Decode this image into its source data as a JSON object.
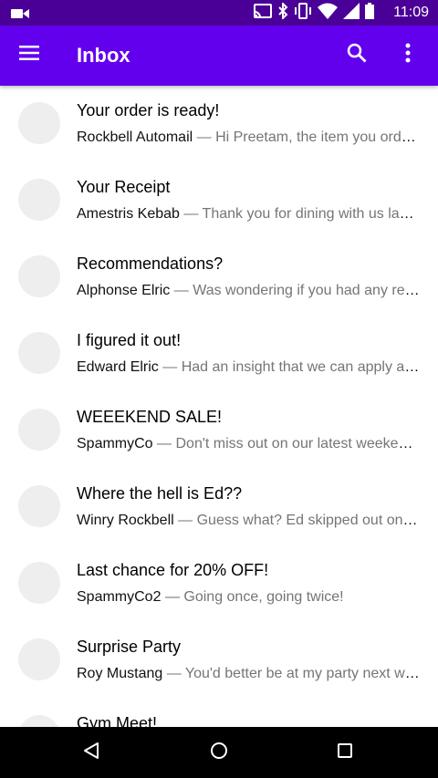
{
  "status_bar": {
    "time": "11:09",
    "icons": [
      "video-icon",
      "cast-icon",
      "bluetooth-icon",
      "vibrate-icon",
      "wifi-icon",
      "signal-icon",
      "battery-icon"
    ]
  },
  "app_bar": {
    "title": "Inbox",
    "icons": [
      "menu-icon",
      "search-icon",
      "more-vert-icon"
    ]
  },
  "colors": {
    "status_bar": "#4a0096",
    "app_bar": "#6200ee",
    "avatar": "#eeeeee",
    "nav_bar": "#000000"
  },
  "emails": [
    {
      "subject": "Your order is ready!",
      "sender": "Rockbell Automail",
      "separator": "—",
      "snippet": "Hi Preetam, the item you ordered is ready"
    },
    {
      "subject": "Your Receipt",
      "sender": "Amestris Kebab",
      "separator": "—",
      "snippet": "Thank you for dining with us last night"
    },
    {
      "subject": "Recommendations?",
      "sender": "Alphonse Elric",
      "separator": "—",
      "snippet": "Was wondering if you had any recommendations"
    },
    {
      "subject": "I figured it out!",
      "sender": "Edward Elric",
      "separator": "—",
      "snippet": "Had an insight that we can apply already"
    },
    {
      "subject": "WEEEKEND SALE!",
      "sender": "SpammyCo",
      "separator": "—",
      "snippet": "Don't miss out on our latest weekend deals"
    },
    {
      "subject": "Where the hell is Ed??",
      "sender": "Winry Rockbell",
      "separator": "—",
      "snippet": "Guess what? Ed skipped out on another"
    },
    {
      "subject": "Last chance for 20% OFF!",
      "sender": "SpammyCo2",
      "separator": "—",
      "snippet": "Going once, going twice!"
    },
    {
      "subject": "Surprise Party",
      "sender": "Roy Mustang",
      "separator": "—",
      "snippet": "You'd better be at my party next week"
    },
    {
      "subject": "Gym Meet!",
      "sender": "",
      "separator": "",
      "snippet": ""
    }
  ],
  "nav_bar": {
    "icons": [
      "back-icon",
      "home-icon",
      "recents-icon"
    ]
  }
}
